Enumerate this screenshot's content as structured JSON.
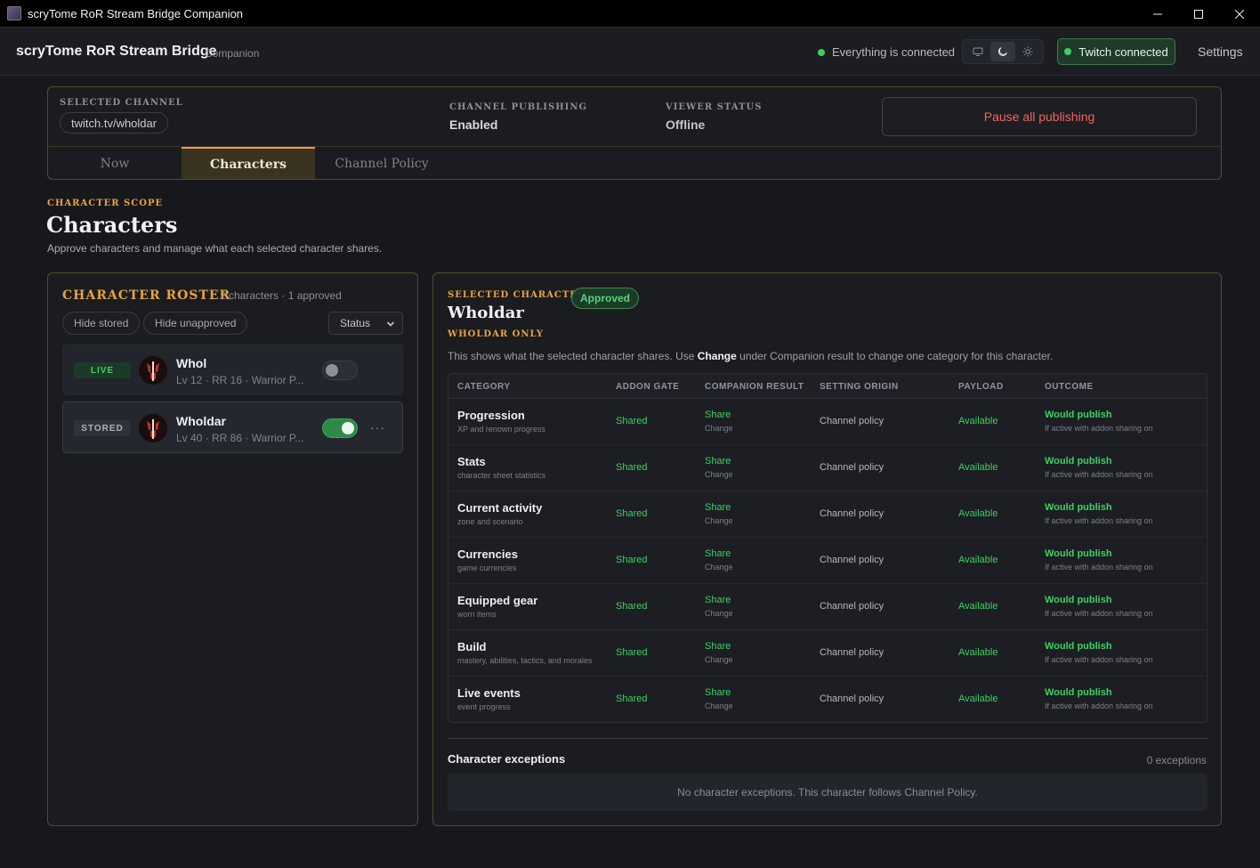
{
  "window": {
    "title": "scryTome RoR Stream Bridge Companion"
  },
  "header": {
    "brand": "scryTome RoR Stream Bridge",
    "brand_sub": "Companion",
    "connection_status": "Everything is connected",
    "twitch_status": "Twitch connected",
    "settings_label": "Settings",
    "theme_options": [
      "monitor-icon",
      "moon-icon",
      "sun-icon"
    ],
    "active_theme": "moon-icon"
  },
  "channel": {
    "selected_label": "SELECTED CHANNEL",
    "selected_value": "twitch.tv/wholdar",
    "publishing_label": "CHANNEL PUBLISHING",
    "publishing_value": "Enabled",
    "viewer_label": "VIEWER STATUS",
    "viewer_value": "Offline",
    "pause_label": "Pause all publishing"
  },
  "tabs": [
    {
      "label": "Now"
    },
    {
      "label": "Characters",
      "active": true
    },
    {
      "label": "Channel Policy"
    }
  ],
  "section": {
    "scope_label": "CHARACTER SCOPE",
    "title": "Characters",
    "description": "Approve characters and manage what each selected character shares."
  },
  "roster": {
    "title": "CHARACTER ROSTER",
    "count": "2 characters · 1 approved",
    "filters": [
      "Hide stored",
      "Hide unapproved"
    ],
    "sort_value": "Status",
    "characters": [
      {
        "badge": "LIVE",
        "name": "Whol",
        "meta": "Lv 12 · RR 16 · Warrior P...",
        "enabled": false
      },
      {
        "badge": "STORED",
        "name": "Wholdar",
        "meta": "Lv 40 · RR 86 · Warrior P...",
        "enabled": true,
        "more": "···"
      }
    ]
  },
  "detail": {
    "selected_label": "SELECTED CHARACTER",
    "approved_label": "Approved",
    "name": "Wholdar",
    "scope_label": "WHOLDAR ONLY",
    "desc_before": "This shows what the selected character shares. Use ",
    "desc_bold": "Change",
    "desc_after": " under Companion result to change one category for this character.",
    "columns": [
      "CATEGORY",
      "ADDON GATE",
      "COMPANION RESULT",
      "SETTING ORIGIN",
      "PAYLOAD",
      "OUTCOME"
    ],
    "rows": [
      {
        "name": "Progression",
        "sub": "XP and renown progress",
        "gate": "Shared",
        "result": "Share",
        "change": "Change",
        "origin": "Channel policy",
        "payload": "Available",
        "outcome": "Would publish",
        "outcome_sub": "If active with addon sharing on"
      },
      {
        "name": "Stats",
        "sub": "character sheet statistics",
        "gate": "Shared",
        "result": "Share",
        "change": "Change",
        "origin": "Channel policy",
        "payload": "Available",
        "outcome": "Would publish",
        "outcome_sub": "If active with addon sharing on"
      },
      {
        "name": "Current activity",
        "sub": "zone and scenario",
        "gate": "Shared",
        "result": "Share",
        "change": "Change",
        "origin": "Channel policy",
        "payload": "Available",
        "outcome": "Would publish",
        "outcome_sub": "If active with addon sharing on"
      },
      {
        "name": "Currencies",
        "sub": "game currencies",
        "gate": "Shared",
        "result": "Share",
        "change": "Change",
        "origin": "Channel policy",
        "payload": "Available",
        "outcome": "Would publish",
        "outcome_sub": "If active with addon sharing on"
      },
      {
        "name": "Equipped gear",
        "sub": "worn items",
        "gate": "Shared",
        "result": "Share",
        "change": "Change",
        "origin": "Channel policy",
        "payload": "Available",
        "outcome": "Would publish",
        "outcome_sub": "If active with addon sharing on"
      },
      {
        "name": "Build",
        "sub": "mastery, abilities, tactics, and morales",
        "gate": "Shared",
        "result": "Share",
        "change": "Change",
        "origin": "Channel policy",
        "payload": "Available",
        "outcome": "Would publish",
        "outcome_sub": "If active with addon sharing on"
      },
      {
        "name": "Live events",
        "sub": "event progress",
        "gate": "Shared",
        "result": "Share",
        "change": "Change",
        "origin": "Channel policy",
        "payload": "Available",
        "outcome": "Would publish",
        "outcome_sub": "If active with addon sharing on"
      }
    ],
    "exceptions_title": "Character exceptions",
    "exceptions_count": "0 exceptions",
    "exceptions_empty": "No character exceptions. This character follows Channel Policy."
  }
}
